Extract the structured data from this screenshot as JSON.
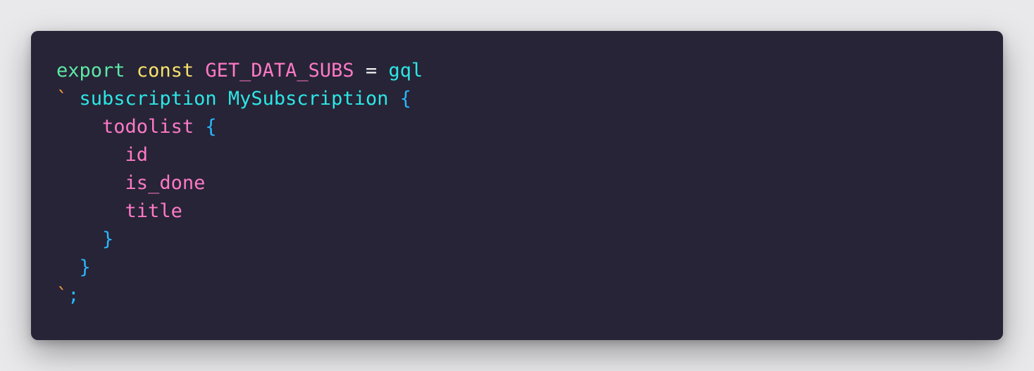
{
  "colors": {
    "background": "#e9e9ec",
    "editor_background": "#262436",
    "keyword_export": "#5ee8a6",
    "keyword_const": "#f9e16a",
    "identifier_pink": "#ff79c6",
    "function_cyan": "#2ee6e6",
    "brace_blue": "#2bb6ff",
    "operator_white": "#f2f2f2",
    "backtick_orange": "#ff9a3c"
  },
  "code_lines": [
    {
      "tokens": [
        {
          "text": "export",
          "color": "#5ee8a6"
        },
        {
          "text": " ",
          "color": "#f2f2f2"
        },
        {
          "text": "const",
          "color": "#f9e16a"
        },
        {
          "text": " ",
          "color": "#f2f2f2"
        },
        {
          "text": "GET_DATA_SUBS",
          "color": "#ff79c6"
        },
        {
          "text": " = ",
          "color": "#f2f2f2"
        },
        {
          "text": "gql",
          "color": "#2ee6e6"
        }
      ]
    },
    {
      "tokens": [
        {
          "text": "`",
          "color": "#ff9a3c"
        },
        {
          "text": " ",
          "color": "#f2f2f2"
        },
        {
          "text": "subscription",
          "color": "#2ee6e6"
        },
        {
          "text": " ",
          "color": "#f2f2f2"
        },
        {
          "text": "MySubscription",
          "color": "#2ee6e6"
        },
        {
          "text": " ",
          "color": "#f2f2f2"
        },
        {
          "text": "{",
          "color": "#2bb6ff"
        }
      ]
    },
    {
      "tokens": [
        {
          "text": "    ",
          "color": "#f2f2f2"
        },
        {
          "text": "todolist",
          "color": "#ff79c6"
        },
        {
          "text": " ",
          "color": "#f2f2f2"
        },
        {
          "text": "{",
          "color": "#2bb6ff"
        }
      ]
    },
    {
      "tokens": [
        {
          "text": "      ",
          "color": "#f2f2f2"
        },
        {
          "text": "id",
          "color": "#ff79c6"
        }
      ]
    },
    {
      "tokens": [
        {
          "text": "      ",
          "color": "#f2f2f2"
        },
        {
          "text": "is_done",
          "color": "#ff79c6"
        }
      ]
    },
    {
      "tokens": [
        {
          "text": "      ",
          "color": "#f2f2f2"
        },
        {
          "text": "title",
          "color": "#ff79c6"
        }
      ]
    },
    {
      "tokens": [
        {
          "text": "    ",
          "color": "#f2f2f2"
        },
        {
          "text": "}",
          "color": "#2bb6ff"
        }
      ]
    },
    {
      "tokens": [
        {
          "text": "  ",
          "color": "#f2f2f2"
        },
        {
          "text": "}",
          "color": "#2bb6ff"
        }
      ]
    },
    {
      "tokens": [
        {
          "text": "`",
          "color": "#ff9a3c"
        },
        {
          "text": ";",
          "color": "#2bb6ff"
        }
      ]
    }
  ]
}
